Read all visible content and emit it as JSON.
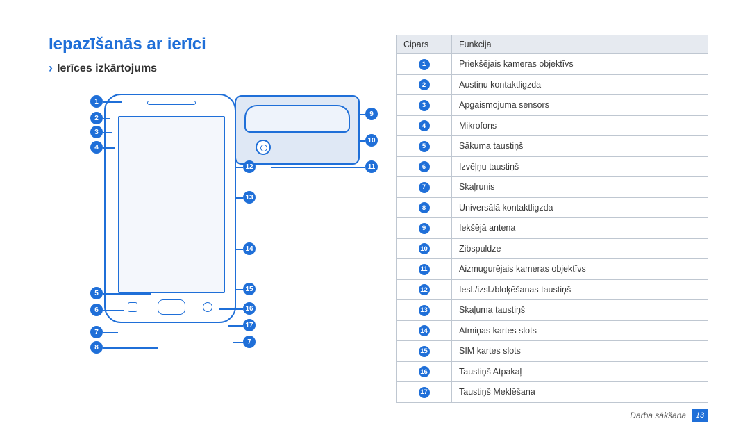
{
  "title": "Iepazīšanās ar ierīci",
  "subtitle": "Ierīces izkārtojums",
  "table": {
    "headers": {
      "num": "Cipars",
      "func": "Funkcija"
    },
    "rows": [
      {
        "n": 1,
        "f": "Priekšējais kameras objektīvs"
      },
      {
        "n": 2,
        "f": "Austiņu kontaktligzda"
      },
      {
        "n": 3,
        "f": "Apgaismojuma sensors"
      },
      {
        "n": 4,
        "f": "Mikrofons"
      },
      {
        "n": 5,
        "f": "Sākuma taustiņš"
      },
      {
        "n": 6,
        "f": "Izvēļņu taustiņš"
      },
      {
        "n": 7,
        "f": "Skaļrunis"
      },
      {
        "n": 8,
        "f": "Universālā kontaktligzda"
      },
      {
        "n": 9,
        "f": "Iekšējā antena"
      },
      {
        "n": 10,
        "f": "Zibspuldze"
      },
      {
        "n": 11,
        "f": "Aizmugurējais kameras objektīvs"
      },
      {
        "n": 12,
        "f": "Iesl./izsl./bloķēšanas taustiņš"
      },
      {
        "n": 13,
        "f": "Skaļuma taustiņš"
      },
      {
        "n": 14,
        "f": "Atmiņas kartes slots"
      },
      {
        "n": 15,
        "f": "SIM kartes slots"
      },
      {
        "n": 16,
        "f": "Taustiņš Atpakaļ"
      },
      {
        "n": 17,
        "f": "Taustiņš Meklēšana"
      }
    ]
  },
  "callouts": {
    "left": [
      1,
      2,
      3,
      4,
      5,
      6,
      7,
      8
    ],
    "right": [
      9,
      10,
      11,
      12,
      13,
      14,
      15,
      16,
      17,
      7
    ]
  },
  "footer": {
    "section": "Darba sākšana",
    "page": "13"
  }
}
